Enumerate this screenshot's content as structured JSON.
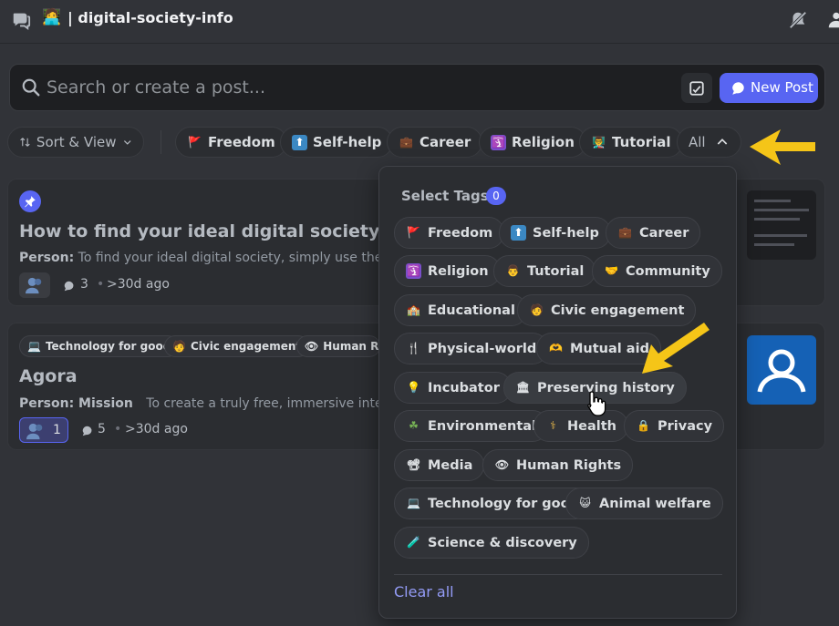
{
  "topbar": {
    "channel_emoji": "🧑‍💻",
    "title": "| digital-society-info"
  },
  "search": {
    "placeholder": "Search or create a post...",
    "new_post_label": "New Post"
  },
  "filters": {
    "sort_label": "Sort & View",
    "tags": [
      {
        "label": "Freedom",
        "emoji": "🚩"
      },
      {
        "label": "Self-help",
        "emoji": "⬆"
      },
      {
        "label": "Career",
        "emoji": "💼"
      },
      {
        "label": "Religion",
        "emoji": "🛐"
      },
      {
        "label": "Tutorial",
        "emoji": "👨‍🏫"
      }
    ],
    "all_label": "All"
  },
  "posts": [
    {
      "title": "How to find your ideal digital society",
      "author": "Person:",
      "body": "To find your ideal digital society, simply use the labels",
      "replies": "3",
      "age": ">30d ago"
    },
    {
      "tags": [
        {
          "label": "Technology for good",
          "emoji": "💻"
        },
        {
          "label": "Civic engagement",
          "emoji": "🧑"
        },
        {
          "label": "Human Righ",
          "emoji": "👁"
        }
      ],
      "title": "Agora",
      "author": "Person: Mission",
      "body": "To create a truly free, immersive internet by",
      "participants": "1",
      "replies": "5",
      "age": ">30d ago"
    }
  ],
  "tag_menu": {
    "heading": "Select Tags",
    "count": "0",
    "tags": [
      {
        "label": "Freedom",
        "emoji": "🚩"
      },
      {
        "label": "Self-help",
        "emoji": "⬆"
      },
      {
        "label": "Career",
        "emoji": "💼"
      },
      {
        "label": "Religion",
        "emoji": "🛐"
      },
      {
        "label": "Tutorial",
        "emoji": "👨"
      },
      {
        "label": "Community",
        "emoji": "🤝"
      },
      {
        "label": "Educational",
        "emoji": "🏫"
      },
      {
        "label": "Civic engagement",
        "emoji": "🧑"
      },
      {
        "label": "Physical-world",
        "emoji": "🍴"
      },
      {
        "label": "Mutual aid",
        "emoji": "🫶"
      },
      {
        "label": "Incubator",
        "emoji": "💡"
      },
      {
        "label": "Preserving history",
        "emoji": "🏛"
      },
      {
        "label": "Environmental",
        "emoji": "☘"
      },
      {
        "label": "Health",
        "emoji": "⚕"
      },
      {
        "label": "Privacy",
        "emoji": "🔒"
      },
      {
        "label": "Media",
        "emoji": "📽"
      },
      {
        "label": "Human Rights",
        "emoji": "👁"
      },
      {
        "label": "Technology for good",
        "emoji": "💻"
      },
      {
        "label": "Animal welfare",
        "emoji": "😺"
      },
      {
        "label": "Science & discovery",
        "emoji": "🧪"
      }
    ],
    "clear_label": "Clear all"
  },
  "colors": {
    "accent": "#5865f2",
    "background": "#313338",
    "annotation_arrow": "#f5c518"
  }
}
